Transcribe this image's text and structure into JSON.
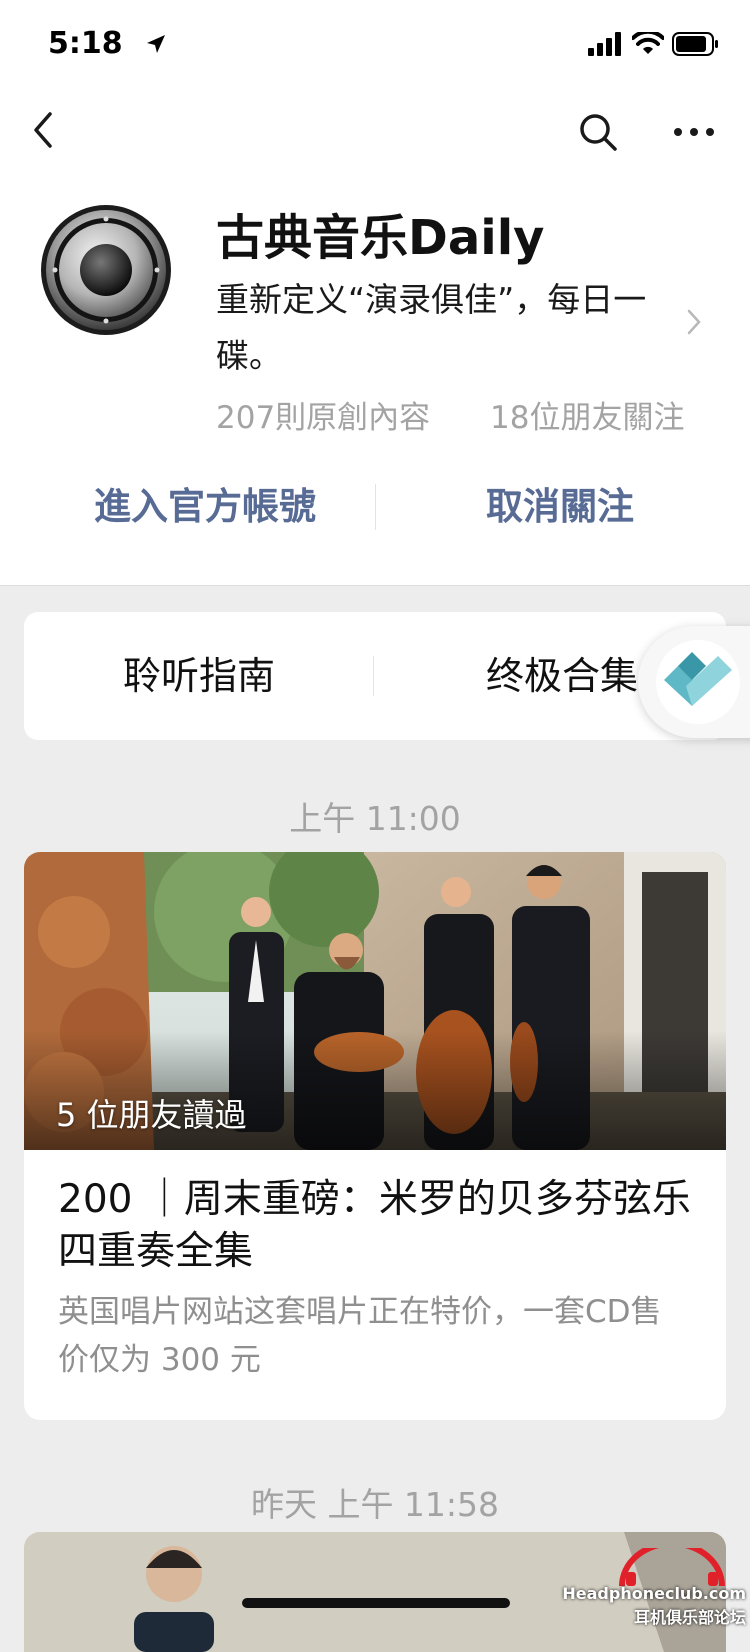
{
  "status_bar": {
    "time": "5:18"
  },
  "account": {
    "name": "古典音乐Daily",
    "description": "重新定义“演录俱佳”，每日一碟。",
    "original_count": "207則原創內容",
    "friends_following": "18位朋友關注"
  },
  "actions": {
    "enter": "進入官方帳號",
    "unfollow": "取消關注"
  },
  "menu": {
    "items": [
      {
        "label": "聆听指南"
      },
      {
        "label": "终极合集"
      }
    ]
  },
  "feed": {
    "items": [
      {
        "time": "上午 11:00",
        "friends_read": "5 位朋友讀過",
        "title": "200 ｜周末重磅：米罗的贝多芬弦乐四重奏全集",
        "digest": "英国唱片网站这套唱片正在特价，一套CD售价仅为 300 元"
      },
      {
        "time": "昨天 上午 11:58"
      }
    ]
  },
  "watermark": {
    "line1": "Headphoneclub.com",
    "line2": "耳机俱乐部论坛"
  },
  "colors": {
    "link": "#576b95",
    "background": "#ededed",
    "muted": "#a3a3a3"
  },
  "icons": [
    "location-arrow-icon",
    "signal-icon",
    "wifi-icon",
    "battery-icon",
    "back-icon",
    "search-icon",
    "more-icon",
    "speaker-avatar-icon",
    "chevron-right-icon",
    "floating-heart-icon"
  ]
}
